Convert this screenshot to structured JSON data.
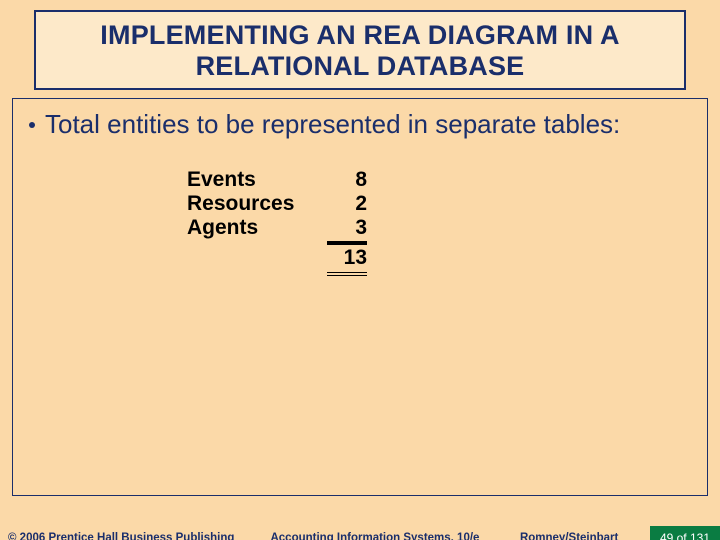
{
  "title": {
    "line1": "IMPLEMENTING AN REA DIAGRAM IN A",
    "line2": "RELATIONAL DATABASE"
  },
  "bullet": "Total entities to be represented in separate tables:",
  "tally": {
    "rows": [
      {
        "label": "Events",
        "value": "8"
      },
      {
        "label": "Resources",
        "value": "2"
      },
      {
        "label": "Agents",
        "value": "3"
      }
    ],
    "total": "13"
  },
  "footer": {
    "copyright": "© 2006 Prentice Hall Business Publishing",
    "center": "Accounting Information Systems, 10/e",
    "authors": "Romney/Steinbart",
    "page": "49 of 131"
  }
}
